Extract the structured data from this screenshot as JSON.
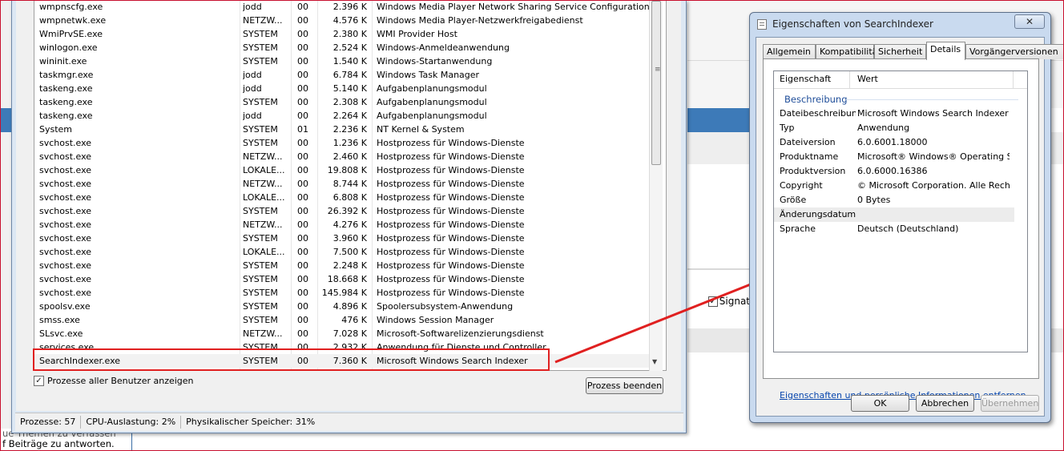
{
  "task_manager": {
    "rows": [
      {
        "name": "wmpnscfg.exe",
        "user": "jodd",
        "cpu": "00",
        "mem": "2.396 K",
        "desc": "Windows Media Player Network Sharing Service Configuration A..."
      },
      {
        "name": "wmpnetwk.exe",
        "user": "NETZW...",
        "cpu": "00",
        "mem": "4.576 K",
        "desc": "Windows Media Player-Netzwerkfreigabedienst"
      },
      {
        "name": "WmiPrvSE.exe",
        "user": "SYSTEM",
        "cpu": "00",
        "mem": "2.380 K",
        "desc": "WMI Provider Host"
      },
      {
        "name": "winlogon.exe",
        "user": "SYSTEM",
        "cpu": "00",
        "mem": "2.524 K",
        "desc": "Windows-Anmeldeanwendung"
      },
      {
        "name": "wininit.exe",
        "user": "SYSTEM",
        "cpu": "00",
        "mem": "1.540 K",
        "desc": "Windows-Startanwendung"
      },
      {
        "name": "taskmgr.exe",
        "user": "jodd",
        "cpu": "00",
        "mem": "6.784 K",
        "desc": "Windows Task Manager"
      },
      {
        "name": "taskeng.exe",
        "user": "jodd",
        "cpu": "00",
        "mem": "5.140 K",
        "desc": "Aufgabenplanungsmodul"
      },
      {
        "name": "taskeng.exe",
        "user": "SYSTEM",
        "cpu": "00",
        "mem": "2.308 K",
        "desc": "Aufgabenplanungsmodul"
      },
      {
        "name": "taskeng.exe",
        "user": "jodd",
        "cpu": "00",
        "mem": "2.264 K",
        "desc": "Aufgabenplanungsmodul"
      },
      {
        "name": "System",
        "user": "SYSTEM",
        "cpu": "01",
        "mem": "2.236 K",
        "desc": "NT Kernel & System"
      },
      {
        "name": "svchost.exe",
        "user": "SYSTEM",
        "cpu": "00",
        "mem": "1.236 K",
        "desc": "Hostprozess für Windows-Dienste"
      },
      {
        "name": "svchost.exe",
        "user": "NETZW...",
        "cpu": "00",
        "mem": "2.460 K",
        "desc": "Hostprozess für Windows-Dienste"
      },
      {
        "name": "svchost.exe",
        "user": "LOKALE...",
        "cpu": "00",
        "mem": "19.808 K",
        "desc": "Hostprozess für Windows-Dienste"
      },
      {
        "name": "svchost.exe",
        "user": "NETZW...",
        "cpu": "00",
        "mem": "8.744 K",
        "desc": "Hostprozess für Windows-Dienste"
      },
      {
        "name": "svchost.exe",
        "user": "LOKALE...",
        "cpu": "00",
        "mem": "6.808 K",
        "desc": "Hostprozess für Windows-Dienste"
      },
      {
        "name": "svchost.exe",
        "user": "SYSTEM",
        "cpu": "00",
        "mem": "26.392 K",
        "desc": "Hostprozess für Windows-Dienste"
      },
      {
        "name": "svchost.exe",
        "user": "NETZW...",
        "cpu": "00",
        "mem": "4.276 K",
        "desc": "Hostprozess für Windows-Dienste"
      },
      {
        "name": "svchost.exe",
        "user": "SYSTEM",
        "cpu": "00",
        "mem": "3.960 K",
        "desc": "Hostprozess für Windows-Dienste"
      },
      {
        "name": "svchost.exe",
        "user": "LOKALE...",
        "cpu": "00",
        "mem": "7.500 K",
        "desc": "Hostprozess für Windows-Dienste"
      },
      {
        "name": "svchost.exe",
        "user": "SYSTEM",
        "cpu": "00",
        "mem": "2.248 K",
        "desc": "Hostprozess für Windows-Dienste"
      },
      {
        "name": "svchost.exe",
        "user": "SYSTEM",
        "cpu": "00",
        "mem": "18.668 K",
        "desc": "Hostprozess für Windows-Dienste"
      },
      {
        "name": "svchost.exe",
        "user": "SYSTEM",
        "cpu": "00",
        "mem": "145.984 K",
        "desc": "Hostprozess für Windows-Dienste"
      },
      {
        "name": "spoolsv.exe",
        "user": "SYSTEM",
        "cpu": "00",
        "mem": "4.896 K",
        "desc": "Spoolersubsystem-Anwendung"
      },
      {
        "name": "smss.exe",
        "user": "SYSTEM",
        "cpu": "00",
        "mem": "476 K",
        "desc": "Windows Session Manager"
      },
      {
        "name": "SLsvc.exe",
        "user": "NETZW...",
        "cpu": "00",
        "mem": "7.028 K",
        "desc": "Microsoft-Softwarelizenzierungsdienst"
      },
      {
        "name": "services.exe",
        "user": "SYSTEM",
        "cpu": "00",
        "mem": "2.932 K",
        "desc": "Anwendung für Dienste und Controller"
      },
      {
        "name": "SearchIndexer.exe",
        "user": "SYSTEM",
        "cpu": "00",
        "mem": "7.360 K",
        "desc": "Microsoft Windows Search Indexer"
      }
    ],
    "show_all_users_label": "Prozesse aller Benutzer anzeigen",
    "end_process_label": "Prozess beenden",
    "status": {
      "processes": "Prozesse: 57",
      "cpu": "CPU-Auslastung: 2%",
      "memory": "Physikalischer Speicher: 31%"
    }
  },
  "background": {
    "signat_label": "Signat",
    "bottom_line1": "ue Themen zu verfassen",
    "bottom_line2": "f Beiträge zu antworten."
  },
  "dialog": {
    "title": "Eigenschaften von SearchIndexer",
    "close_symbol": "✕",
    "tabs": [
      "Allgemein",
      "Kompatibilität",
      "Sicherheit",
      "Details",
      "Vorgängerversionen"
    ],
    "active_tab": "Details",
    "columns": {
      "property": "Eigenschaft",
      "value": "Wert"
    },
    "group": "Beschreibung",
    "properties": [
      {
        "key": "Dateibeschreibung",
        "value": "Microsoft Windows Search Indexer"
      },
      {
        "key": "Typ",
        "value": "Anwendung"
      },
      {
        "key": "Dateiversion",
        "value": "6.0.6001.18000"
      },
      {
        "key": "Produktname",
        "value": "Microsoft® Windows® Operating Syst..."
      },
      {
        "key": "Produktversion",
        "value": "6.0.6000.16386"
      },
      {
        "key": "Copyright",
        "value": "© Microsoft Corporation. Alle Rechte ..."
      },
      {
        "key": "Größe",
        "value": "0 Bytes"
      },
      {
        "key": "Änderungsdatum",
        "value": ""
      },
      {
        "key": "Sprache",
        "value": "Deutsch (Deutschland)"
      }
    ],
    "link": "Eigenschaften und persönliche Informationen entfernen",
    "ok_label": "OK",
    "cancel_label": "Abbrechen",
    "apply_label": "Übernehmen"
  },
  "colors": {
    "annotation_red": "#e02020",
    "dialog_frame": "#c9daef",
    "link_blue": "#0645ad"
  }
}
